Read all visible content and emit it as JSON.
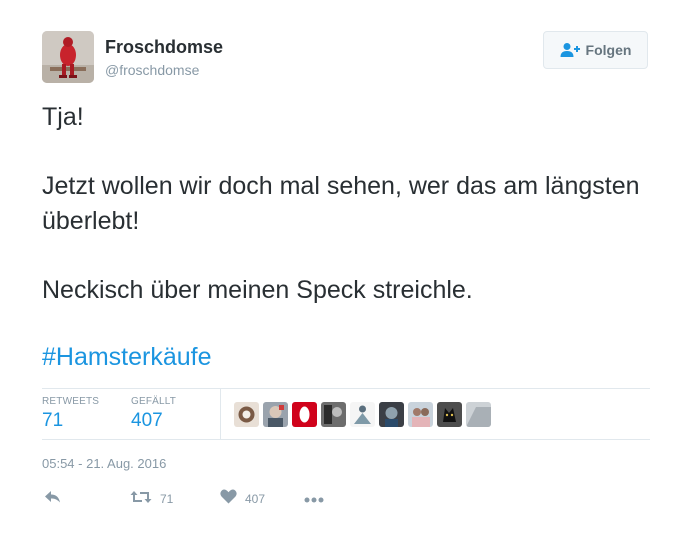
{
  "user": {
    "name": "Froschdomse",
    "handle": "@froschdomse"
  },
  "follow": {
    "label": "Folgen"
  },
  "tweet": {
    "line1": "Tja!",
    "line2": "Jetzt wollen wir doch mal sehen, wer das am längsten überlebt!",
    "line3": "Neckisch über meinen Speck streichle.",
    "hashtag": "#Hamsterkäufe",
    "timestamp": "05:54 - 21. Aug. 2016"
  },
  "stats": {
    "retweets_label": "RETWEETS",
    "retweets_value": "71",
    "likes_label": "GEFÄLLT",
    "likes_value": "407"
  },
  "likers": [
    "avatar",
    "avatar",
    "avatar",
    "avatar",
    "avatar",
    "avatar",
    "avatar",
    "avatar",
    "avatar"
  ],
  "actions": {
    "retweet_count": "71",
    "like_count": "407"
  },
  "colors": {
    "link": "#1b95e0",
    "muted": "#8899a6",
    "text": "#292f33",
    "border": "#e1e8ed"
  },
  "icons": [
    "follow-person-plus-icon",
    "reply-icon",
    "retweet-icon",
    "heart-icon",
    "more-icon"
  ]
}
